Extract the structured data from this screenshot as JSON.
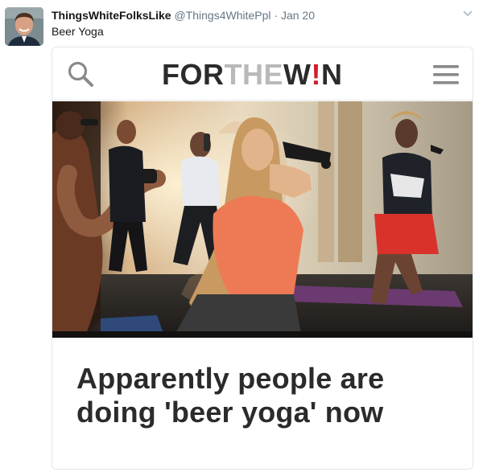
{
  "tweet": {
    "display_name": "ThingsWhiteFolksLike",
    "handle": "@Things4WhitePpl",
    "separator": "·",
    "timestamp": "Jan 20",
    "text": "Beer Yoga"
  },
  "card": {
    "logo": {
      "part1": "FOR",
      "part2": "THE",
      "part3": "W",
      "part4": "!",
      "part5": "N"
    },
    "title": "Apparently people are doing 'beer yoga' now"
  },
  "colors": {
    "logo_dark": "#2b2b2b",
    "logo_light": "#b9b9b9",
    "logo_accent": "#d21e2b",
    "meta_gray": "#657786"
  },
  "icons": [
    "avatar",
    "chevron-down-icon",
    "search-icon",
    "hamburger-menu-icon"
  ]
}
